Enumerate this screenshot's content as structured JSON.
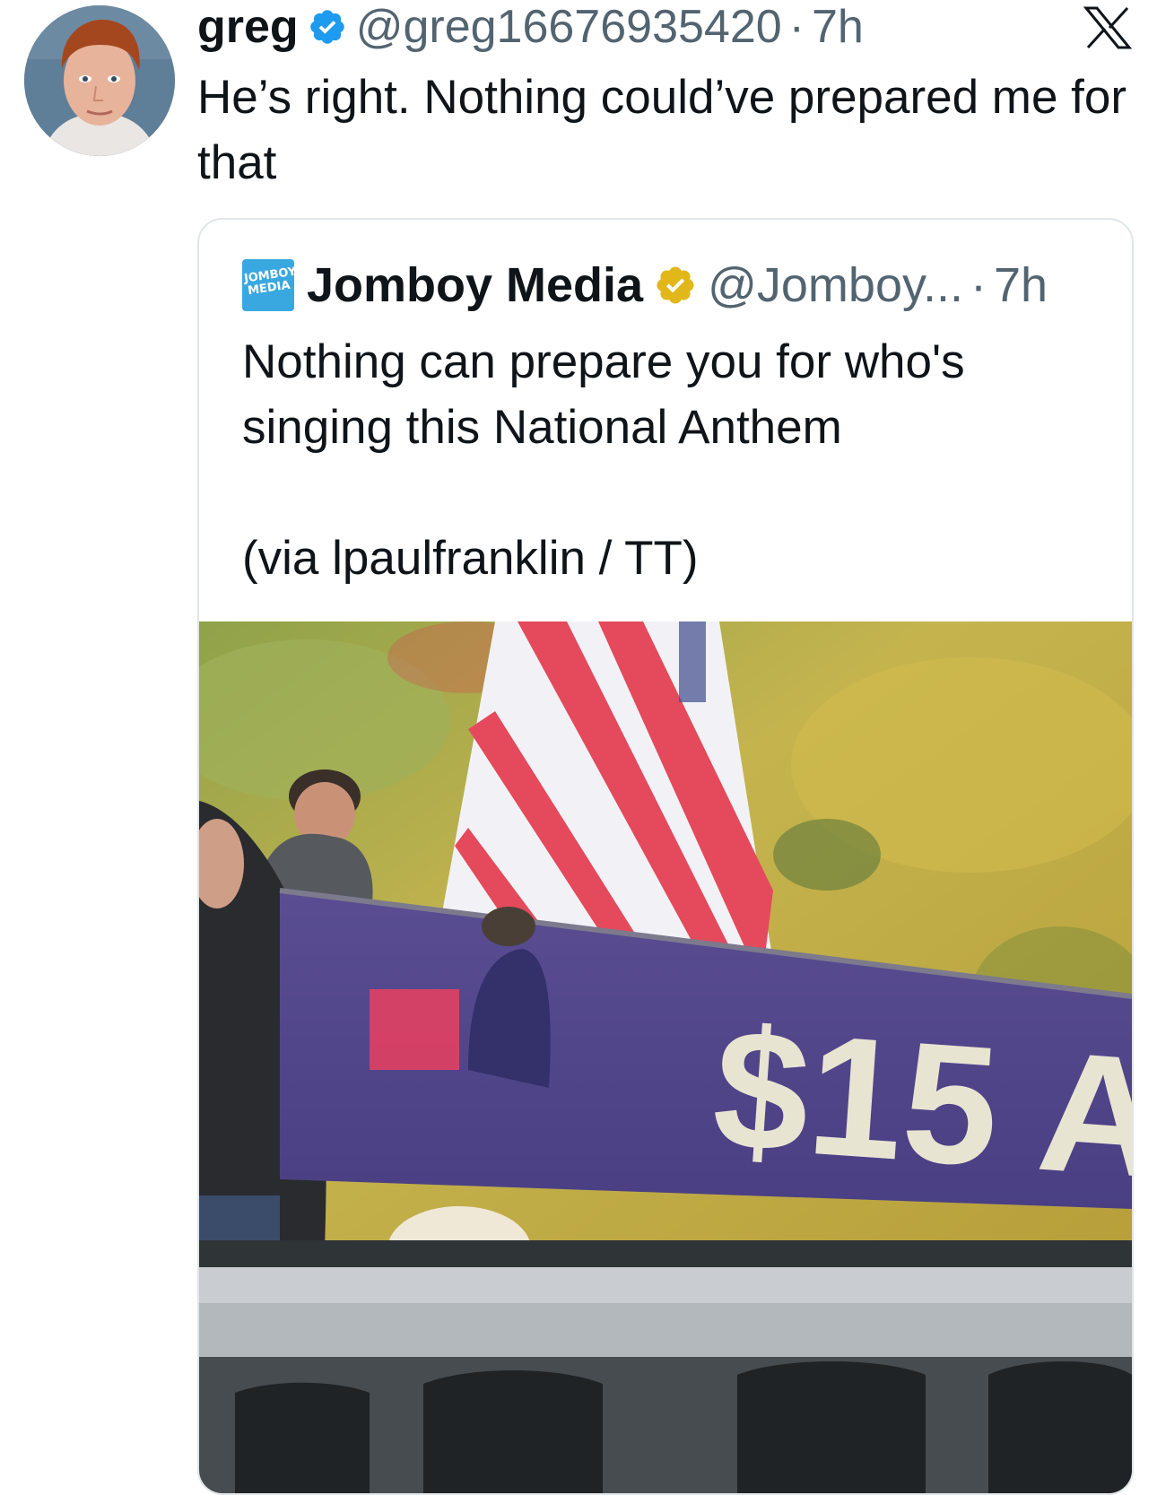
{
  "tweet": {
    "author": {
      "name": "greg",
      "handle": "@greg16676935420",
      "time": "7h",
      "verified": true,
      "avatar_icon": "profile-photo"
    },
    "separator": "·",
    "text": "He’s right. Nothing could’ve prepared me for that",
    "platform_icon": "x-logo-icon"
  },
  "quote": {
    "author": {
      "name": "Jomboy Media",
      "handle": "@Jomboy...",
      "time": "7h",
      "verified_gold": true,
      "logo_lines": [
        "JOMBOY",
        "MEDIA"
      ]
    },
    "separator": "·",
    "text": "Nothing can prepare you for who's singing this National Anthem",
    "via": "(via lpaulfranklin / TT)",
    "media": {
      "banner_text": "$15 A"
    }
  },
  "colors": {
    "text_primary": "#0f1419",
    "text_secondary": "#536471",
    "verified_blue": "#1d9bf0",
    "verified_gold": "#e2b719",
    "card_border": "#e1e6ea"
  }
}
